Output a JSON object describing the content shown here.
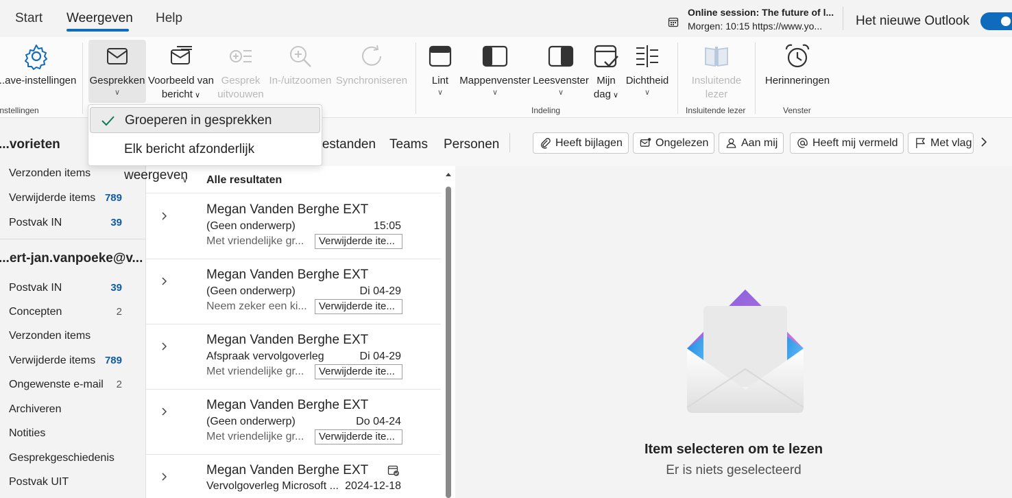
{
  "tabs": [
    {
      "label": "Start"
    },
    {
      "label": "Weergeven",
      "active": true
    },
    {
      "label": "Help"
    }
  ],
  "session": {
    "title": "Online session: The future of l...",
    "detail": "Morgen: 10:15  https://www.yo..."
  },
  "new_outlook": {
    "label": "Het nieuwe Outlook",
    "enabled": true
  },
  "ribbon": {
    "groups": [
      {
        "label": "Instellingen"
      },
      {
        "label": "Indeling"
      },
      {
        "label": "Insluitende lezer"
      },
      {
        "label": "Venster"
      }
    ],
    "buttons": {
      "view_settings": {
        "label": "...ave-instellingen",
        "icon": "gear-icon"
      },
      "conversations": {
        "label": "Gesprekken",
        "icon": "envelope-icon"
      },
      "message_preview": {
        "line1": "Voorbeeld van",
        "line2": "bericht",
        "icon": "message-preview-icon"
      },
      "conversation_expand": {
        "line1": "Gesprek",
        "line2": "uitvouwen",
        "icon": "expand-icon",
        "disabled": true
      },
      "zoom": {
        "label": "In-/uitzoomen",
        "icon": "zoom-icon",
        "disabled": true
      },
      "sync": {
        "label": "Synchroniseren",
        "icon": "sync-icon",
        "disabled": true
      },
      "ribbon": {
        "label": "Lint",
        "icon": "ribbon-layout-icon"
      },
      "folder_pane": {
        "label": "Mappenvenster",
        "icon": "folder-pane-icon"
      },
      "reading_pane": {
        "label": "Leesvenster",
        "icon": "reading-pane-icon"
      },
      "my_day": {
        "line1": "Mijn",
        "line2": "dag",
        "icon": "calendar-check-icon"
      },
      "density": {
        "label": "Dichtheid",
        "icon": "density-icon"
      },
      "immersive_reader": {
        "line1": "Insluitende",
        "line2": "lezer",
        "icon": "immersive-reader-icon",
        "disabled": true
      },
      "reminders": {
        "label": "Herinneringen",
        "icon": "alarm-clock-icon"
      }
    }
  },
  "dropdown": {
    "items": [
      {
        "label": "Groeperen in gesprekken",
        "checked": true
      },
      {
        "label": "Elk bericht afzonderlijk weergeven",
        "checked": false
      }
    ]
  },
  "sidebar": {
    "favorites_header": "...vorieten",
    "favorites": [
      {
        "label": "Verzonden items",
        "count": ""
      },
      {
        "label": "Verwijderde items",
        "count": "789"
      },
      {
        "label": "Postvak IN",
        "count": "39"
      }
    ],
    "account_header": "...ert-jan.vanpoeke@v...",
    "account_items": [
      {
        "label": "Postvak IN",
        "count": "39"
      },
      {
        "label": "Concepten",
        "count": "2"
      },
      {
        "label": "Verzonden items",
        "count": ""
      },
      {
        "label": "Verwijderde items",
        "count": "789"
      },
      {
        "label": "Ongewenste e-mail",
        "count": "2"
      },
      {
        "label": "Archiveren",
        "count": ""
      },
      {
        "label": "Notities",
        "count": ""
      },
      {
        "label": "Gesprekgeschiedenis",
        "count": ""
      },
      {
        "label": "Postvak UIT",
        "count": ""
      }
    ]
  },
  "filters": {
    "tabs": [
      "...estanden",
      "Teams",
      "Personen"
    ],
    "chips": [
      {
        "label": "Heeft bijlagen",
        "icon": "paperclip-icon"
      },
      {
        "label": "Ongelezen",
        "icon": "unread-mail-icon"
      },
      {
        "label": "Aan mij",
        "icon": "person-icon"
      },
      {
        "label": "Heeft mij vermeld",
        "icon": "at-sign-icon"
      },
      {
        "label": "Met vlag",
        "icon": "flag-icon"
      }
    ]
  },
  "mail_list": {
    "header": "Alle resultaten",
    "messages": [
      {
        "from": "Megan Vanden Berghe EXT",
        "subject": "(Geen onderwerp)",
        "date": "15:05",
        "preview": "Met vriendelijke gr...",
        "folder": "Verwijderde ite..."
      },
      {
        "from": "Megan Vanden Berghe EXT",
        "subject": "(Geen onderwerp)",
        "date": "Di 04-29",
        "preview": "Neem zeker een ki...",
        "folder": "Verwijderde ite..."
      },
      {
        "from": "Megan Vanden Berghe EXT",
        "subject": "Afspraak vervolgoverleg",
        "date": "Di 04-29",
        "preview": "Met vriendelijke gr...",
        "folder": "Verwijderde ite..."
      },
      {
        "from": "Megan Vanden Berghe EXT",
        "subject": "(Geen onderwerp)",
        "date": "Do 04-24",
        "preview": "Met vriendelijke gr...",
        "folder": "Verwijderde ite..."
      },
      {
        "from": "Megan Vanden Berghe EXT",
        "subject": "Vervolgoverleg Microsoft ...",
        "date": "2024-12-18",
        "preview": "",
        "folder": "",
        "calendar_icon": true
      }
    ]
  },
  "reading_pane": {
    "title": "Item selecteren om te lezen",
    "subtitle": "Er is niets geselecteerd"
  },
  "colors": {
    "accent": "#0f6cbd",
    "badge_blue": "#0f5ba7"
  }
}
